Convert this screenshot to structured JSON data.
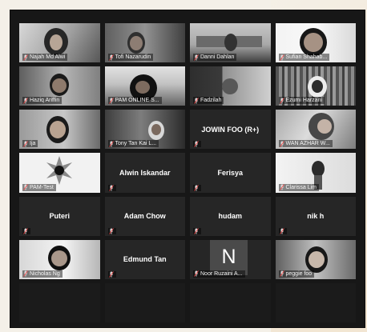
{
  "participants": [
    {
      "name": "Najah Md Alwi"
    },
    {
      "name": "Tofi Nazarudin"
    },
    {
      "name": "Danni Dahlan"
    },
    {
      "name": "Sufian Shahab..."
    },
    {
      "name": "Haziq Ariffin"
    },
    {
      "name": "PAM ONLINE S..."
    },
    {
      "name": "Fadzilah"
    },
    {
      "name": "Ezumi Harzani"
    },
    {
      "name": "Ija"
    },
    {
      "name": "Tony Tan Kai L..."
    },
    {
      "name": "JOWIN FOO (R+)"
    },
    {
      "name": "WAN AZHAR W..."
    },
    {
      "name": "PAM-Test"
    },
    {
      "name": "Alwin Iskandar"
    },
    {
      "name": "Ferisya"
    },
    {
      "name": "Clarissa Lim"
    },
    {
      "name": "Puteri"
    },
    {
      "name": "Adam Chow"
    },
    {
      "name": "hudam"
    },
    {
      "name": "nik h"
    },
    {
      "name": "Nicholas Ng"
    },
    {
      "name": "Edmund Tan"
    },
    {
      "name": "Noor Ruzaini A...",
      "initial": "N"
    },
    {
      "name": "peggie foo"
    }
  ],
  "icons": {
    "mic": "mic-muted-icon"
  }
}
